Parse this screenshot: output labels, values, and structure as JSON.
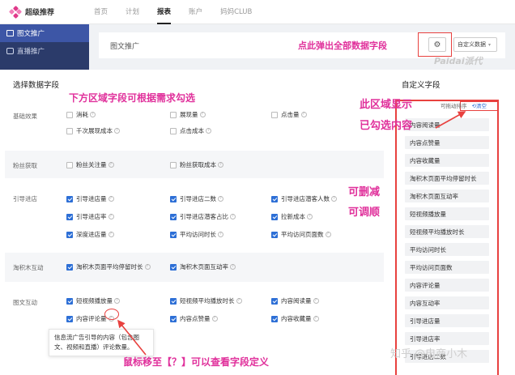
{
  "nav": {
    "logo": "超级推荐",
    "items": [
      {
        "label": "首页",
        "active": false
      },
      {
        "label": "计划",
        "active": false
      },
      {
        "label": "报表",
        "active": true
      },
      {
        "label": "账户",
        "active": false
      },
      {
        "label": "妈妈CLUB",
        "active": false
      }
    ]
  },
  "sidebar": {
    "items": [
      {
        "label": "图文推广",
        "active": true
      },
      {
        "label": "直播推广",
        "active": false
      }
    ]
  },
  "header": {
    "title": "图文推广",
    "custom_select": "自定义数据"
  },
  "watermark_paidai": "Paidai派代",
  "modal": {
    "title": "选择数据字段",
    "custom_title": "自定义字段",
    "sort_label": "可拖动排序",
    "clear_label": "清空"
  },
  "categories": [
    {
      "name": "基础效果",
      "fields": [
        {
          "label": "消耗",
          "checked": false
        },
        {
          "label": "展现量",
          "checked": false
        },
        {
          "label": "点击量",
          "checked": false
        },
        {
          "label": "千次展现成本",
          "checked": false
        },
        {
          "label": "点击成本",
          "checked": false
        }
      ]
    },
    {
      "name": "粉丝获取",
      "fields": [
        {
          "label": "粉丝关注量",
          "checked": false
        },
        {
          "label": "粉丝获取成本",
          "checked": false
        }
      ]
    },
    {
      "name": "引导进店",
      "fields": [
        {
          "label": "引导进店量",
          "checked": true
        },
        {
          "label": "引导进店二数",
          "checked": true
        },
        {
          "label": "引导进店潜客人数",
          "checked": true
        },
        {
          "label": "引导进店率",
          "checked": true
        },
        {
          "label": "引导进店潜客占比",
          "checked": true
        },
        {
          "label": "拉新成本",
          "checked": true
        },
        {
          "label": "深度进店量",
          "checked": true
        },
        {
          "label": "平均访问时长",
          "checked": true
        },
        {
          "label": "平均访问页面数",
          "checked": true
        }
      ]
    },
    {
      "name": "淘积木互动",
      "fields": [
        {
          "label": "淘积木页面平均停留时长",
          "checked": true
        },
        {
          "label": "淘积木页面互动率",
          "checked": true
        }
      ]
    },
    {
      "name": "图文互动",
      "fields": [
        {
          "label": "短视频播放量",
          "checked": true
        },
        {
          "label": "短视频平均播放时长",
          "checked": true
        },
        {
          "label": "内容阅读量",
          "checked": true
        },
        {
          "label": "内容评论量",
          "checked": true
        },
        {
          "label": "内容点赞量",
          "checked": true
        },
        {
          "label": "内容收藏量",
          "checked": true
        }
      ]
    }
  ],
  "tooltip": "信息流广告引导的内容（包含图文、视频和直播）评论数量。",
  "custom_fields": [
    "内容阅读量",
    "内容点赞量",
    "内容收藏量",
    "淘积木页面平均停留时长",
    "淘积木页面互动率",
    "短视频播放量",
    "短视频平均播放时长",
    "平均访问时长",
    "平均访问页面数",
    "内容评论量",
    "内容互动率",
    "引导进店量",
    "引导进店率",
    "引导进店二数"
  ],
  "annotations": {
    "top": "点此弹出全部数据字段",
    "left": "下方区域字段可根据需求勾选",
    "right_1": "此区域显示",
    "right_2": "已勾选内容",
    "mid_1": "可删减",
    "mid_2": "可调顺",
    "bottom": "鼠标移至【？】可以查看字段定义"
  },
  "watermark_zhihu": "知乎 @电商小木"
}
